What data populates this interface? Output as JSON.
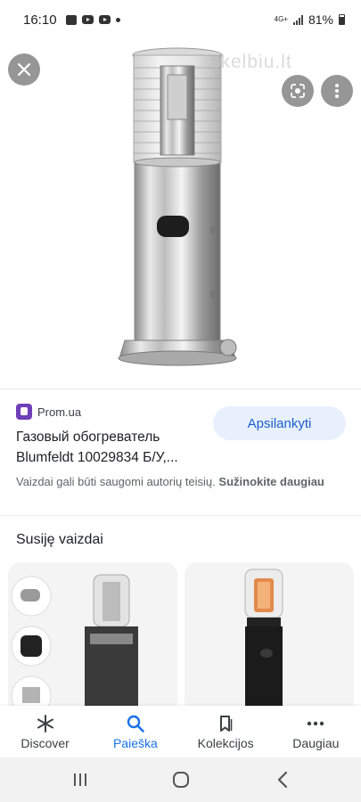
{
  "status_bar": {
    "time": "16:10",
    "network": "4G+",
    "battery": "81%"
  },
  "viewer": {
    "watermark": "skelbiu.lt",
    "close_icon": "close-icon",
    "lens_icon": "google-lens-icon",
    "more_icon": "more-vert-icon"
  },
  "result": {
    "source_name": "Prom.ua",
    "title": "Газовый обогреватель Blumfeldt 10029834 Б/У,...",
    "visit_label": "Apsilankyti",
    "copyright_text": "Vaizdai gali būti saugomi autorių teisių.",
    "learn_more_label": "Sužinokite daugiau",
    "colors": {
      "accent": "#1a5ec9",
      "button_bg": "#e8f0fe",
      "source_logo": "#6f3fb8"
    }
  },
  "related": {
    "title": "Susiję vaizdai"
  },
  "bottom_nav": {
    "items": [
      {
        "label": "Discover",
        "icon": "asterisk-icon"
      },
      {
        "label": "Paieška",
        "icon": "search-icon",
        "active": true
      },
      {
        "label": "Kolekcijos",
        "icon": "bookmark-icon"
      },
      {
        "label": "Daugiau",
        "icon": "more-horiz-icon"
      }
    ]
  },
  "system_nav": {
    "buttons": [
      "recents-icon",
      "home-icon",
      "back-icon"
    ]
  }
}
